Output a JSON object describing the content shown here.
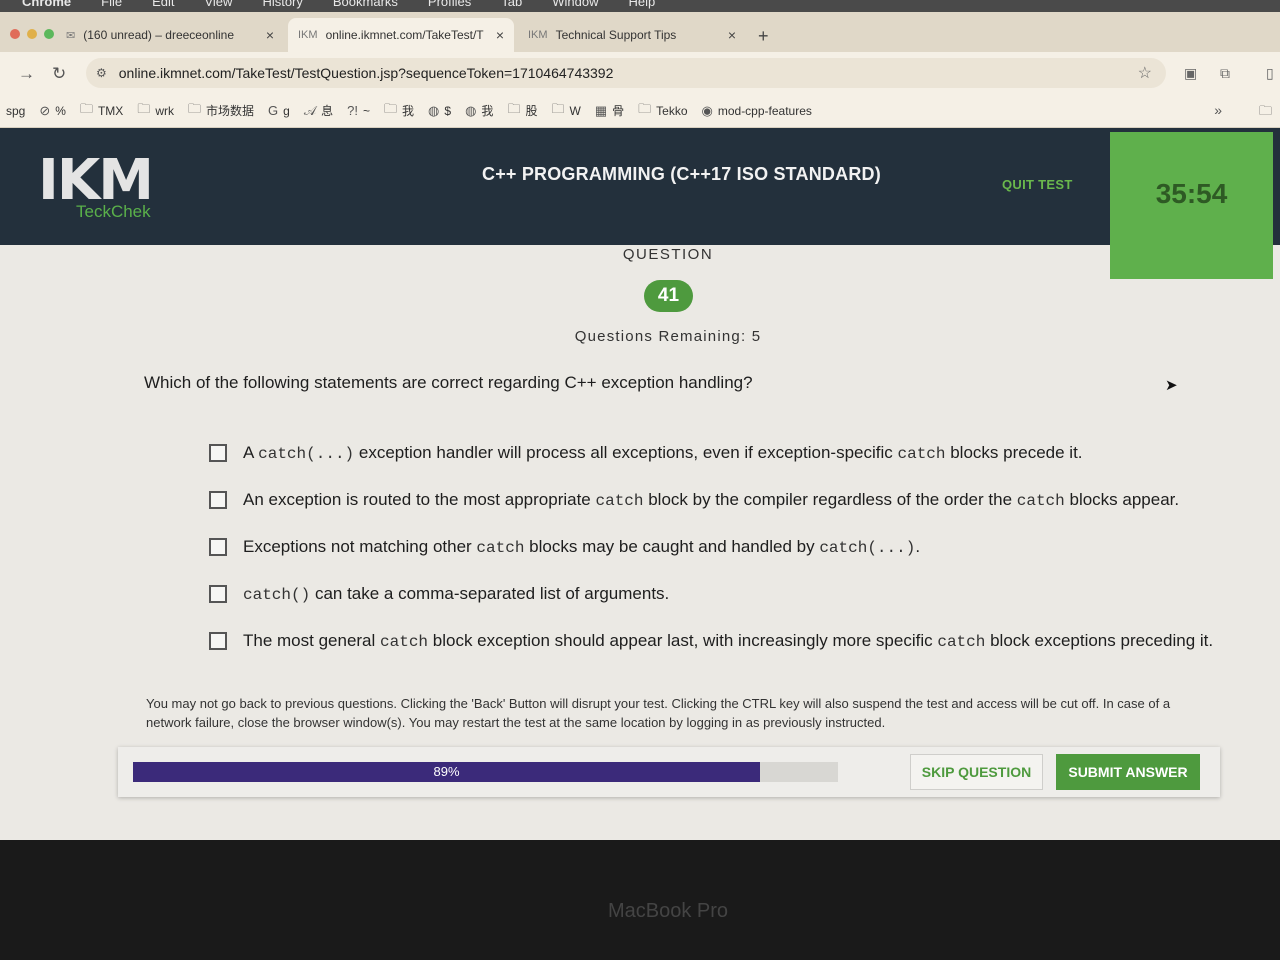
{
  "menubar": {
    "items": [
      "Chrome",
      "File",
      "Edit",
      "View",
      "History",
      "Bookmarks",
      "Profiles",
      "Tab",
      "Window",
      "Help"
    ]
  },
  "tabs": [
    {
      "label": "(160 unread) – dreeceonline",
      "icon": "mail-icon",
      "close": "×"
    },
    {
      "label": "online.ikmnet.com/TakeTest/T",
      "icon": "ikm-icon",
      "close": "×"
    },
    {
      "label": "Technical Support Tips",
      "icon": "ikm-icon",
      "close": "×"
    }
  ],
  "new_tab": "+",
  "address_bar": {
    "url": "online.ikmnet.com/TakeTest/TestQuestion.jsp?sequenceToken=1710464743392"
  },
  "bookmarks": [
    {
      "label": "spg",
      "icon": ""
    },
    {
      "label": "%",
      "icon": "forbidden-icon"
    },
    {
      "label": "TMX",
      "icon": "folder-icon"
    },
    {
      "label": "wrk",
      "icon": "folder-icon"
    },
    {
      "label": "市场数据",
      "icon": "folder-icon"
    },
    {
      "label": "g",
      "icon": "google-icon"
    },
    {
      "label": "息",
      "icon": "script-a-icon"
    },
    {
      "label": "~",
      "icon": "exclaim-icon"
    },
    {
      "label": "我",
      "icon": "folder-icon"
    },
    {
      "label": "$",
      "icon": "globe-icon"
    },
    {
      "label": "我",
      "icon": "globe-icon"
    },
    {
      "label": "股",
      "icon": "folder-icon"
    },
    {
      "label": "W",
      "icon": "folder-icon"
    },
    {
      "label": "骨",
      "icon": "grid-icon"
    },
    {
      "label": "Tekko",
      "icon": "folder-icon"
    },
    {
      "label": "mod-cpp-features",
      "icon": "github-icon"
    }
  ],
  "bookmarks_more": "»",
  "header": {
    "logo": "IKM",
    "logo_sub": "TeckChek",
    "test_title": "C++ PROGRAMMING (C++17 ISO STANDARD)",
    "quit_label": "QUIT TEST",
    "timer": "35:54"
  },
  "question": {
    "label": "QUESTION",
    "number": "41",
    "remaining": "Questions Remaining: 5",
    "text": "Which of the following statements are correct regarding C++ exception handling?"
  },
  "options": [
    {
      "parts": [
        "A ",
        "catch(...)",
        " exception handler will process all exceptions, even if exception-specific ",
        "catch",
        " blocks precede it."
      ]
    },
    {
      "parts": [
        "An exception is routed to the most appropriate ",
        "catch",
        " block by the compiler regardless of the order the ",
        "catch",
        " blocks appear."
      ]
    },
    {
      "parts": [
        "Exceptions not matching other ",
        "catch",
        " blocks may be caught and handled by ",
        "catch(...)",
        "."
      ]
    },
    {
      "parts": [
        "",
        "catch()",
        " can take a comma-separated list of arguments.",
        "",
        ""
      ]
    },
    {
      "parts": [
        "The most general ",
        "catch",
        " block exception should appear last, with increasingly more specific ",
        "catch",
        " block exceptions preceding it."
      ]
    }
  ],
  "notice": "You may not go back to previous questions. Clicking the 'Back' Button will disrupt your test. Clicking the CTRL key will also suspend the test and access will be cut off. In case of a network failure, close the browser window(s). You may restart the test at the same location by logging in as previously instructed.",
  "progress": {
    "value": 0.89,
    "label": "89%"
  },
  "buttons": {
    "skip": "SKIP QUESTION",
    "submit": "SUBMIT ANSWER"
  },
  "bezel": "MacBook Pro",
  "colors": {
    "brand_green": "#5ab04a",
    "header_bg": "#23303c",
    "progress_fill": "#3b2a7a"
  }
}
